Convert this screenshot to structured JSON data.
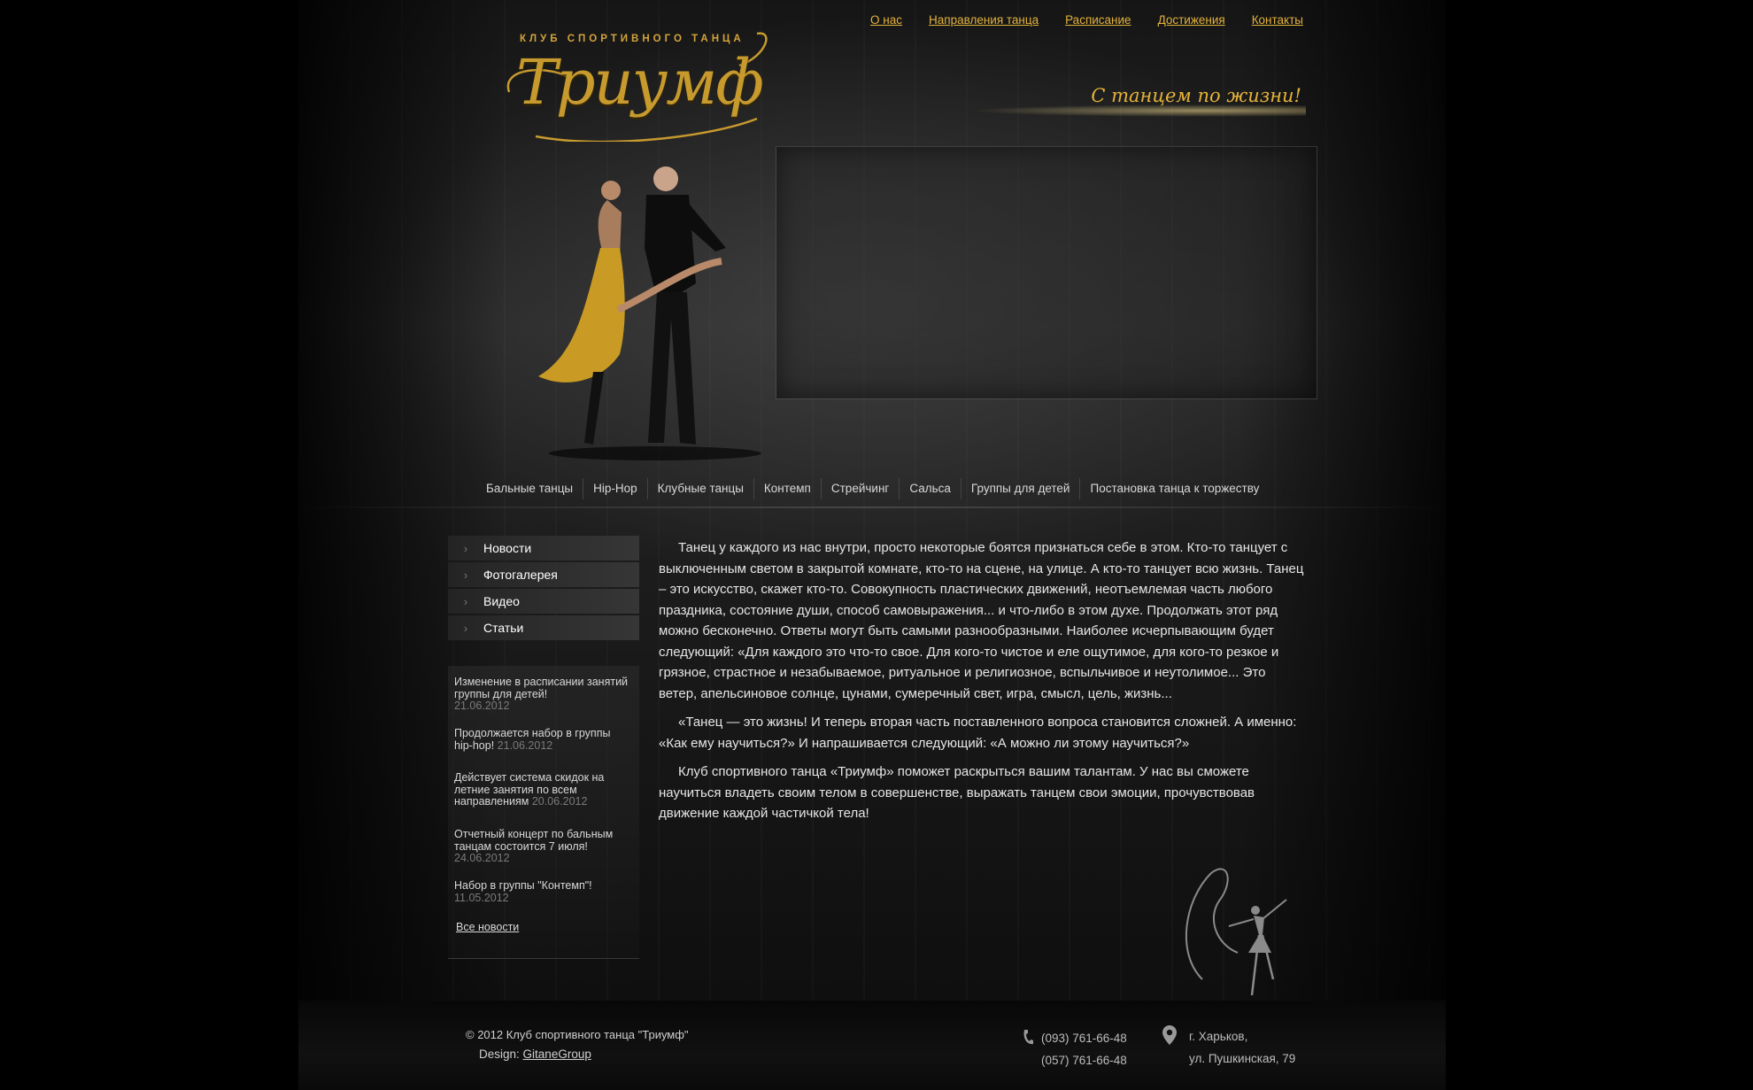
{
  "top_nav": [
    "О нас",
    "Направления танца",
    "Расписание",
    "Достижения",
    "Контакты"
  ],
  "logo": {
    "small": "КЛУБ СПОРТИВНОГО ТАНЦА",
    "big": "Триумф"
  },
  "slogan": "С танцем по жизни!",
  "dance_nav": [
    "Бальные танцы",
    "Hip-Hop",
    "Клубные танцы",
    "Контемп",
    "Стрейчинг",
    "Сальса",
    "Группы для детей",
    "Постановка танца к торжеству"
  ],
  "side_menu": [
    "Новости",
    "Фотогалерея",
    "Видео",
    "Статьи"
  ],
  "news": [
    {
      "title": "Изменение в расписании занятий группы для детей!",
      "date": "21.06.2012"
    },
    {
      "title": "Продолжается набор в группы hip-hop!",
      "date": "21.06.2012"
    },
    {
      "title": "Действует система скидок на летние занятия по всем направлениям",
      "date": "20.06.2012"
    },
    {
      "title": "Отчетный концерт по бальным танцам состоится 7 июля!",
      "date": "24.06.2012"
    },
    {
      "title": "Набор в группы \"Контемп\"!",
      "date": "11.05.2012"
    }
  ],
  "all_news": "Все новости",
  "main_text": [
    "Танец у каждого из нас внутри, просто некоторые боятся признаться себе в этом. Кто-то танцует с выключенным светом в закрытой комнате, кто-то на сцене, на улице. А кто-то танцует всю жизнь. Танец – это искусство, скажет кто-то. Совокупность пластических движений, неотъемлемая часть любого праздника, состояние души, способ самовыражения... и что-либо в этом духе. Продолжать этот ряд можно бесконечно. Ответы могут быть самыми разнообразными. Наиболее исчерпывающим будет следующий: «Для каждого это что-то свое. Для кого-то чистое и еле ощутимое, для кого-то резкое и грязное, страстное и незабываемое, ритуальное и религиозное, вспыльчивое и неутолимое... Это ветер, апельсиновое солнце, цунами, сумеречный свет, игра, смысл, цель, жизнь...",
    "«Танец — это жизнь! И теперь вторая часть поставленного вопроса становится сложней. А именно: «Как ему научиться?» И напрашивается следующий: «А можно ли этому научиться?»",
    "Клуб спортивного танца «Триумф» поможет раскрыться вашим талантам. У нас вы сможете научиться владеть своим телом в совершенстве, выражать танцем свои эмоции, прочувствовав движение каждой частичкой тела!"
  ],
  "footer": {
    "copyright": "©  2012 Клуб спортивного танца \"Триумф\"",
    "design_label": "Design:",
    "design_link": "GitaneGroup",
    "phone1": "(093) 761-66-48",
    "phone2": "(057) 761-66-48",
    "city": "г. Харьков,",
    "street": "ул. Пушкинская, 79"
  },
  "colors": {
    "accent": "#e3b23c",
    "background": "#000000"
  },
  "icons": [
    "chevron-right-icon",
    "phone-icon",
    "map-pin-icon"
  ]
}
